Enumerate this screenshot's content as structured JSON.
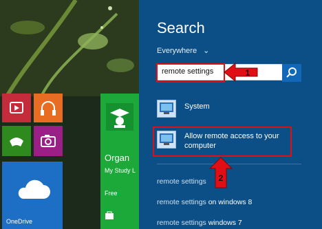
{
  "start": {
    "tiles": {
      "onedrive": "OneDrive",
      "organizer_title": "Organ",
      "organizer_sub": "My Study L",
      "organizer_price": "Free"
    }
  },
  "search": {
    "title": "Search",
    "scope": "Everywhere",
    "query": "remote settings",
    "results": [
      {
        "label": "System"
      },
      {
        "label_line1": "Allow remote access to your",
        "label_line2": "computer"
      }
    ],
    "suggestions": [
      {
        "prefix": "remote settings",
        "suffix": ""
      },
      {
        "prefix": "remote settings",
        "suffix": " on windows 8"
      },
      {
        "prefix": "remote settings",
        "suffix": " windows 7"
      }
    ],
    "annotations": {
      "step1": "1",
      "step2": "2"
    }
  },
  "colors": {
    "panel": "#0b4f86",
    "highlight": "#e10e16",
    "arrow": "#e10e16"
  }
}
